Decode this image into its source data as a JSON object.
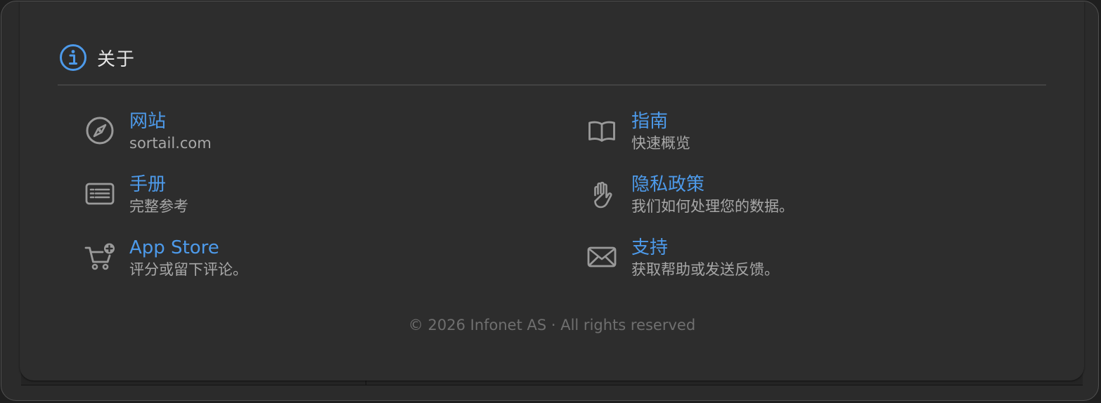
{
  "header": {
    "title": "关于",
    "icon": "info-circle-icon",
    "accent_color": "#4d9aea"
  },
  "items": [
    {
      "id": "website",
      "title": "网站",
      "subtitle": "sortail.com",
      "icon": "compass-icon"
    },
    {
      "id": "guide",
      "title": "指南",
      "subtitle": "快速概览",
      "icon": "book-icon"
    },
    {
      "id": "manual",
      "title": "手册",
      "subtitle": "完整参考",
      "icon": "document-list-icon"
    },
    {
      "id": "privacy",
      "title": "隐私政策",
      "subtitle": "我们如何处理您的数据。",
      "icon": "hand-raised-icon"
    },
    {
      "id": "app-store",
      "title": "App Store",
      "subtitle": "评分或留下评论。",
      "icon": "cart-add-icon"
    },
    {
      "id": "support",
      "title": "支持",
      "subtitle": "获取帮助或发送反馈。",
      "icon": "envelope-icon"
    }
  ],
  "footer": {
    "copyright": "© 2026 Infonet AS · All rights reserved"
  },
  "colors": {
    "link": "#4d9aea",
    "subtitle": "#a8a8a8",
    "icon": "#9a9a9a",
    "panel": "#2d2d2d"
  }
}
